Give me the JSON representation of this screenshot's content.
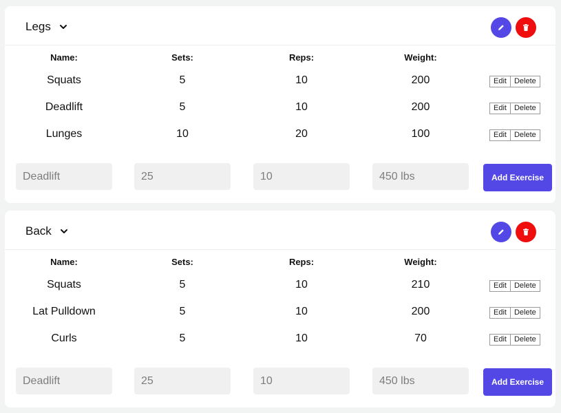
{
  "lists": [
    {
      "title": "Legs",
      "headers": {
        "name": "Name:",
        "sets": "Sets:",
        "reps": "Reps:",
        "weight": "Weight:"
      },
      "rows": [
        {
          "name": "Squats",
          "sets": "5",
          "reps": "10",
          "weight": "200"
        },
        {
          "name": "Deadlift",
          "sets": "5",
          "reps": "10",
          "weight": "200"
        },
        {
          "name": "Lunges",
          "sets": "10",
          "reps": "20",
          "weight": "100"
        }
      ],
      "row_edit_label": "Edit",
      "row_delete_label": "Delete",
      "inputs": {
        "name_placeholder": "Deadlift",
        "sets_placeholder": "25",
        "reps_placeholder": "10",
        "weight_placeholder": "450 lbs"
      },
      "add_label": "Add Exercise"
    },
    {
      "title": "Back",
      "headers": {
        "name": "Name:",
        "sets": "Sets:",
        "reps": "Reps:",
        "weight": "Weight:"
      },
      "rows": [
        {
          "name": "Squats",
          "sets": "5",
          "reps": "10",
          "weight": "210"
        },
        {
          "name": "Lat Pulldown",
          "sets": "5",
          "reps": "10",
          "weight": "200"
        },
        {
          "name": "Curls",
          "sets": "5",
          "reps": "10",
          "weight": "70"
        }
      ],
      "row_edit_label": "Edit",
      "row_delete_label": "Delete",
      "inputs": {
        "name_placeholder": "Deadlift",
        "sets_placeholder": "25",
        "reps_placeholder": "10",
        "weight_placeholder": "450 lbs"
      },
      "add_label": "Add Exercise"
    }
  ],
  "icons": {
    "chevron": "chevron-down-icon",
    "edit": "pencil-icon",
    "delete": "trash-icon"
  },
  "colors": {
    "primary": "#5347e6",
    "danger": "#f00d0d",
    "background": "#f1f4f2",
    "input_bg": "#f0f0f0"
  }
}
